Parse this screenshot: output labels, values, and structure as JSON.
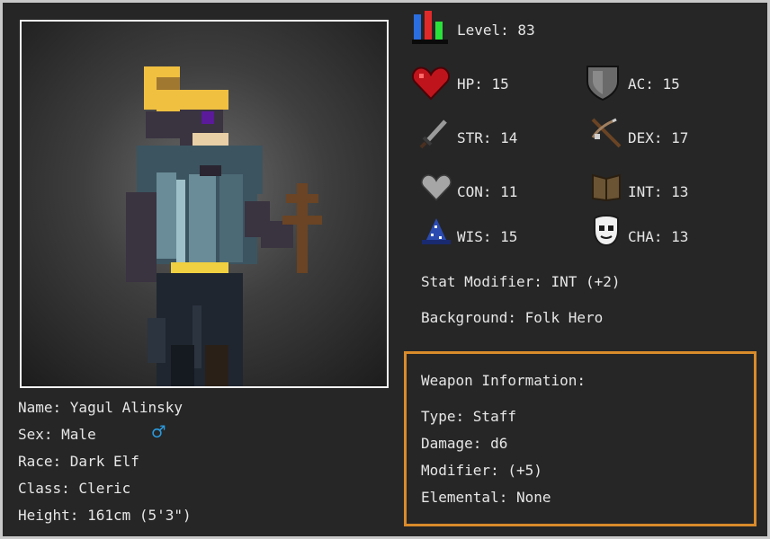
{
  "character": {
    "name_line": "Name: Yagul Alinsky",
    "sex_line": "Sex: Male",
    "race_line": "Race: Dark Elf",
    "class_line": "Class: Cleric",
    "height_line": "Height: 161cm (5'3\")",
    "sex_symbol": "♂",
    "sex_symbol_color": "#2a9be0"
  },
  "level": {
    "label": "Level: 83",
    "icon": "bar-chart-icon"
  },
  "stats": {
    "hp": {
      "label": "HP: 15",
      "icon": "heart-icon"
    },
    "ac": {
      "label": "AC: 15",
      "icon": "shield-icon"
    },
    "str": {
      "label": "STR: 14",
      "icon": "sword-icon"
    },
    "dex": {
      "label": "DEX: 17",
      "icon": "crossbow-icon"
    },
    "con": {
      "label": "CON: 11",
      "icon": "grey-heart-icon"
    },
    "int": {
      "label": "INT: 13",
      "icon": "book-icon"
    },
    "wis": {
      "label": "WIS: 15",
      "icon": "wizard-hat-icon"
    },
    "cha": {
      "label": "CHA: 13",
      "icon": "mask-icon"
    }
  },
  "stat_modifier": "Stat Modifier: INT (+2)",
  "background": "Background: Folk Hero",
  "weapon": {
    "heading": "Weapon Information:",
    "type": "Type: Staff",
    "damage": "Damage: d6",
    "modifier": "Modifier: (+5)",
    "elemental": "Elemental: None"
  },
  "colors": {
    "panel_bg": "#262626",
    "weapon_border": "#d98b2b",
    "portrait_border": "#f2f2f2"
  }
}
